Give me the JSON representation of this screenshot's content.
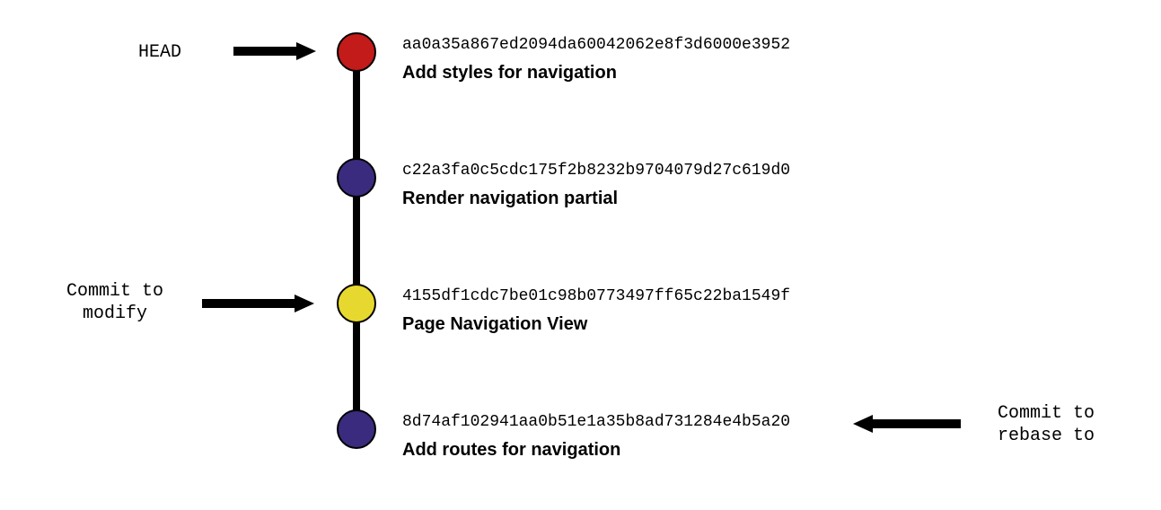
{
  "labels": {
    "head": "HEAD",
    "commit_to_modify_line1": "Commit to",
    "commit_to_modify_line2": "modify",
    "commit_to_rebase_line1": "Commit to",
    "commit_to_rebase_line2": "rebase to"
  },
  "commits": [
    {
      "hash": "aa0a35a867ed2094da60042062e8f3d6000e3952",
      "message": "Add styles for navigation",
      "color": "#c31a1a",
      "role": "head"
    },
    {
      "hash": "c22a3fa0c5cdc175f2b8232b9704079d27c619d0",
      "message": "Render navigation partial",
      "color": "#3b2b7e",
      "role": "normal"
    },
    {
      "hash": "4155df1cdc7be01c98b0773497ff65c22ba1549f",
      "message": "Page Navigation View",
      "color": "#e7d82f",
      "role": "to-modify"
    },
    {
      "hash": "8d74af102941aa0b51e1a35b8ad731284e4b5a20",
      "message": "Add routes for navigation",
      "color": "#3b2b7e",
      "role": "rebase-target"
    }
  ]
}
